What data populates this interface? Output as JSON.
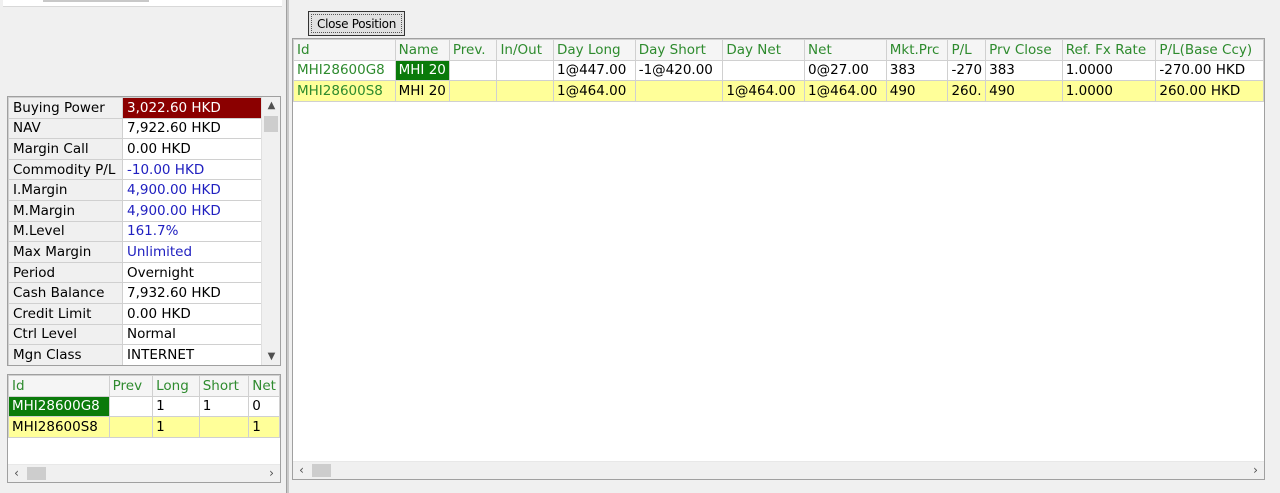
{
  "close_position_label": "Close Position",
  "account": {
    "rows": [
      {
        "label": "Buying Power",
        "value": "3,022.60 HKD",
        "style": "bp"
      },
      {
        "label": "NAV",
        "value": "7,922.60 HKD",
        "style": ""
      },
      {
        "label": "Margin Call",
        "value": "0.00 HKD",
        "style": ""
      },
      {
        "label": "Commodity P/L",
        "value": "-10.00 HKD",
        "style": "blue"
      },
      {
        "label": "I.Margin",
        "value": "4,900.00 HKD",
        "style": "blue"
      },
      {
        "label": "M.Margin",
        "value": "4,900.00 HKD",
        "style": "blue"
      },
      {
        "label": "M.Level",
        "value": "161.7%",
        "style": "blue"
      },
      {
        "label": "Max Margin",
        "value": "Unlimited",
        "style": "blue"
      },
      {
        "label": "Period",
        "value": "Overnight",
        "style": ""
      },
      {
        "label": "Cash Balance",
        "value": "7,932.60 HKD",
        "style": ""
      },
      {
        "label": "Credit Limit",
        "value": "0.00 HKD",
        "style": ""
      },
      {
        "label": "Ctrl Level",
        "value": "Normal",
        "style": ""
      },
      {
        "label": "Mgn Class",
        "value": "INTERNET",
        "style": ""
      }
    ]
  },
  "summary": {
    "columns": [
      "Id",
      "Prev",
      "Long",
      "Short",
      "Net"
    ],
    "rows": [
      {
        "id": "MHI28600G8",
        "prev": "",
        "long": "1",
        "short": "1",
        "net": "0",
        "highlight": false
      },
      {
        "id": "MHI28600S8",
        "prev": "",
        "long": "1",
        "short": "",
        "net": "1",
        "highlight": true
      }
    ]
  },
  "positions": {
    "columns": [
      "Id",
      "Name",
      "Prev.",
      "In/Out",
      "Day Long",
      "Day Short",
      "Day Net",
      "Net",
      "Mkt.Prc",
      "P/L",
      "Prv Close",
      "Ref. Fx Rate",
      "P/L(Base Ccy)"
    ],
    "rows": [
      {
        "id": "MHI28600G8",
        "name": "MHI 20",
        "prev": "",
        "inout": "",
        "day_long": "1@447.00",
        "day_short": "-1@420.00",
        "day_net": "",
        "net": "0@27.00",
        "mkt_prc": "383",
        "pl": "-270",
        "prv_close": "383",
        "fx_rate": "1.0000",
        "pl_base": "-270.00 HKD",
        "highlight": false
      },
      {
        "id": "MHI28600S8",
        "name": "MHI 20",
        "prev": "",
        "inout": "",
        "day_long": "1@464.00",
        "day_short": "",
        "day_net": "1@464.00",
        "net": "1@464.00",
        "mkt_prc": "490",
        "pl": "260.",
        "prv_close": "490",
        "fx_rate": "1.0000",
        "pl_base": "260.00 HKD",
        "highlight": true
      }
    ]
  }
}
